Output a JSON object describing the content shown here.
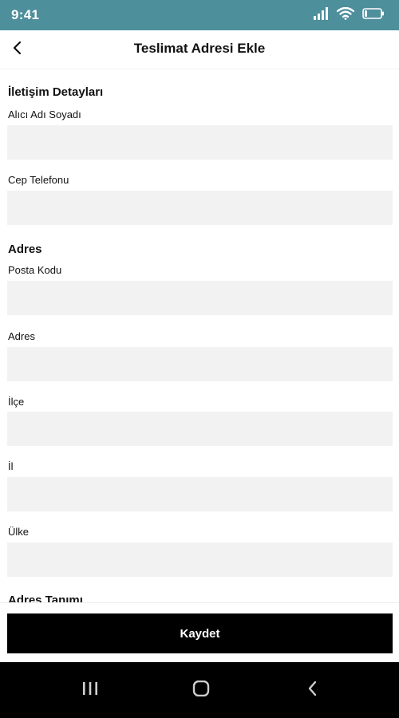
{
  "status_bar": {
    "time": "9:41",
    "icons": [
      "signal-icon",
      "wifi-icon",
      "battery-icon"
    ],
    "background_color": "#4e8f9c"
  },
  "header": {
    "title": "Teslimat Adresi Ekle",
    "back_icon": "chevron-left-icon"
  },
  "form": {
    "contact_section_title": "İletişim Detayları",
    "recipient_name": {
      "label": "Alıcı Adı Soyadı",
      "value": ""
    },
    "mobile_phone": {
      "label": "Cep Telefonu",
      "value": ""
    },
    "address_section_title": "Adres",
    "postal_code": {
      "label": "Posta Kodu",
      "value": ""
    },
    "address": {
      "label": "Adres",
      "value": ""
    },
    "district": {
      "label": "İlçe",
      "value": ""
    },
    "city": {
      "label": "İl",
      "value": ""
    },
    "country": {
      "label": "Ülke",
      "value": ""
    },
    "address_definition_title": "Adres Tanımı"
  },
  "actions": {
    "save_label": "Kaydet"
  },
  "nav_bar": {
    "icons": [
      "recent-apps-icon",
      "home-icon",
      "back-icon"
    ]
  },
  "colors": {
    "input_background": "#f2f2f2",
    "primary_button": "#000000",
    "text": "#111111"
  }
}
